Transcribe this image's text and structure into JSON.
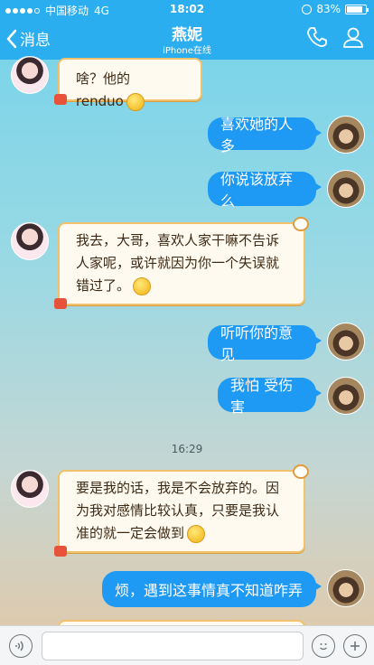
{
  "status_bar": {
    "carrier": "中国移动",
    "network": "4G",
    "time": "18:02",
    "battery": "83%",
    "battery_level": 0.83
  },
  "header": {
    "back_label": "消息",
    "title": "燕妮",
    "subtitle": "iPhone在线"
  },
  "messages": [
    {
      "side": "left",
      "text": "啥？他的renduo"
    },
    {
      "side": "right",
      "text": "喜欢她的人多"
    },
    {
      "side": "right",
      "text": "你说该放弃么"
    },
    {
      "side": "left",
      "text": "我去，大哥，喜欢人家干嘛不告诉人家呢，或许就因为你一个失误就错过了。"
    },
    {
      "side": "right",
      "text": "听听你的意见"
    },
    {
      "side": "right",
      "text": "我怕 受伤害"
    },
    {
      "side": "left",
      "text": "要是我的话，我是不会放弃的。因为我对感情比较认真，只要是我认准的就一定会做到"
    },
    {
      "side": "right",
      "text": "烦，遇到这事情真不知道咋弄"
    }
  ],
  "timestamp": "16:29",
  "colors": {
    "header_bg": "#2aaef0",
    "bubble_right": "#1e9af5",
    "bubble_left_bg": "#fffaf0",
    "bubble_left_border": "#f1c16b"
  },
  "icons": [
    "back-chevron-icon",
    "phone-icon",
    "profile-icon",
    "voice-icon",
    "emoji-icon",
    "plus-icon",
    "smiley-emoji-icon"
  ]
}
